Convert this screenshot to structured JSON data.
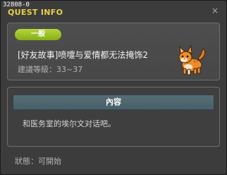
{
  "window": {
    "quest_id": "32808-0",
    "title": "QUEST INFO",
    "close_symbol": "×"
  },
  "quest": {
    "category": "一般",
    "title": "[好友故事]喷嚏与爱情都无法掩饰2",
    "level_range": "建議等級：33~37",
    "npc_icon": "orange-cat-icon"
  },
  "content": {
    "header": "內容",
    "text": "和医务室的埃尔文对话吧。"
  },
  "status": {
    "text": "狀態：可開始"
  },
  "colors": {
    "title": "#e8d24a",
    "badge": "#9cc22a",
    "content_header": "#4f676e"
  }
}
